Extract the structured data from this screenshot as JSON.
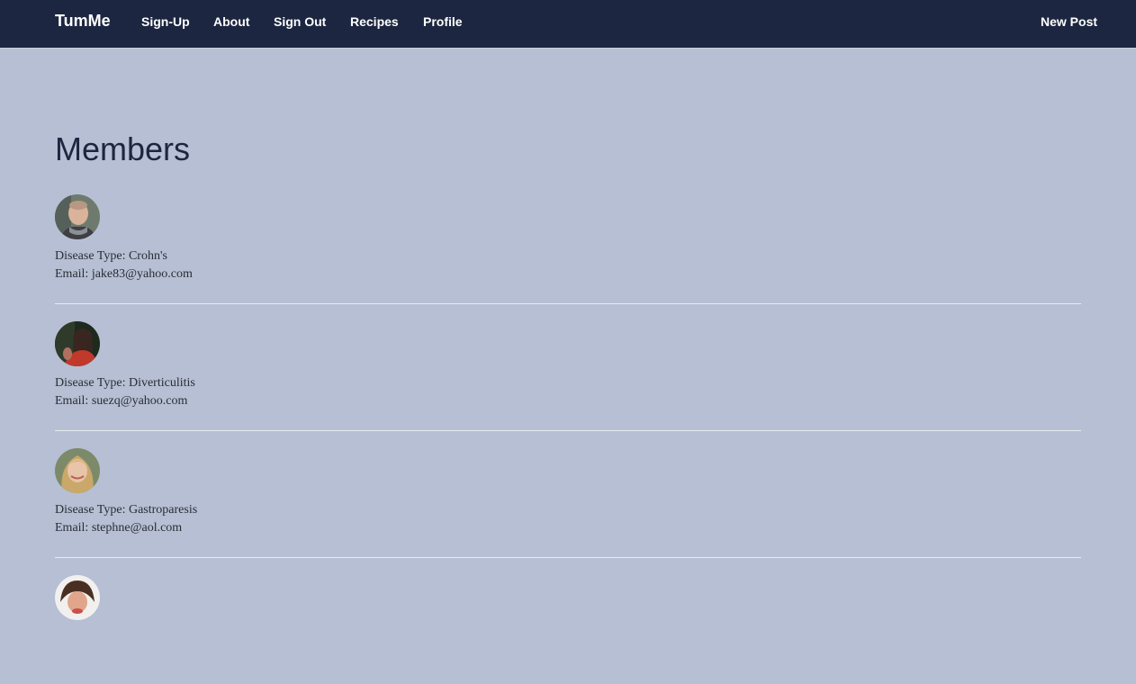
{
  "navbar": {
    "brand": "TumMe",
    "links": [
      "Sign-Up",
      "About",
      "Sign Out",
      "Recipes",
      "Profile"
    ],
    "new_post": "New Post"
  },
  "page": {
    "title": "Members"
  },
  "members": [
    {
      "disease_label": "Disease Type: Crohn's",
      "email_label": "Email: jake83@yahoo.com"
    },
    {
      "disease_label": "Disease Type: Diverticulitis",
      "email_label": "Email: suezq@yahoo.com"
    },
    {
      "disease_label": "Disease Type: Gastroparesis",
      "email_label": "Email: stephne@aol.com"
    },
    {
      "disease_label": "",
      "email_label": ""
    }
  ],
  "colors": {
    "navbar_bg": "#1d2640",
    "page_bg": "#b6bfd3",
    "title": "#1d2640",
    "divider": "#e8ebf2"
  }
}
